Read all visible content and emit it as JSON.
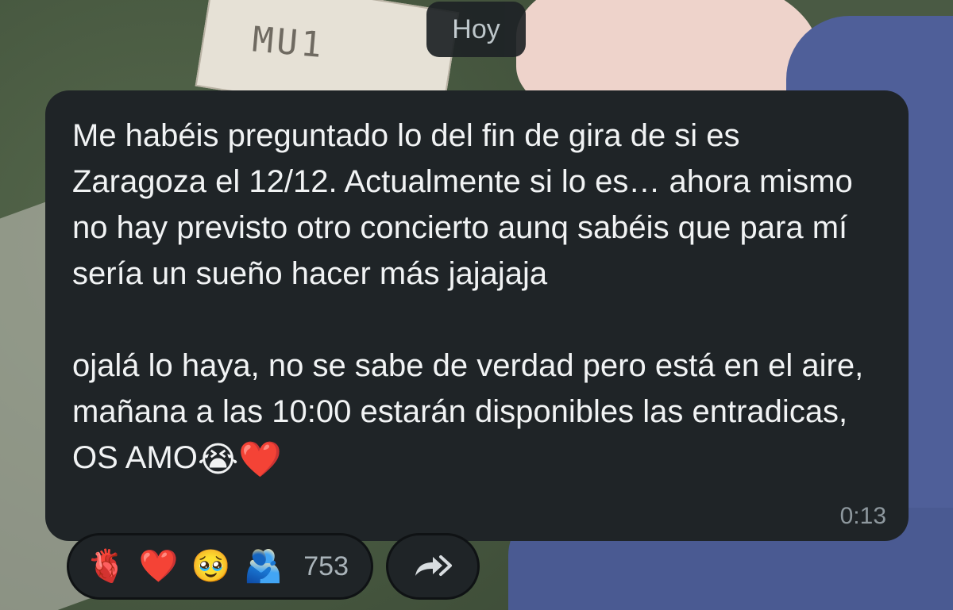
{
  "date_header": "Hoy",
  "wallpaper": {
    "paper_text": "MU1"
  },
  "message": {
    "paragraph1": "Me habéis preguntado lo del fin de gira de si es Zaragoza el 12/12. Actualmente si lo es… ahora mismo no hay previsto otro concierto aunq sabéis que para mí sería un sueño hacer más jajajaja",
    "paragraph2_text": "ojalá lo haya, no se sabe de verdad pero está en el aire, mañana a las 10:00 estarán disponibles las entradicas, OS AMO",
    "paragraph2_emojis": "😭❤️",
    "time": "0:13"
  },
  "reactions": {
    "items": [
      {
        "emoji": "🫀",
        "icon": "anatomical-heart-icon"
      },
      {
        "emoji": "❤️",
        "icon": "red-heart-icon"
      },
      {
        "emoji": "🥹",
        "icon": "holding-back-tears-icon"
      },
      {
        "emoji": "🫂",
        "icon": "people-hugging-icon"
      }
    ],
    "count": "753"
  },
  "share_icon": "forward-arrow-icon",
  "colors": {
    "bubble": "#1f2427",
    "text": "#f1f3f4",
    "meta_text": "#8e989e"
  }
}
